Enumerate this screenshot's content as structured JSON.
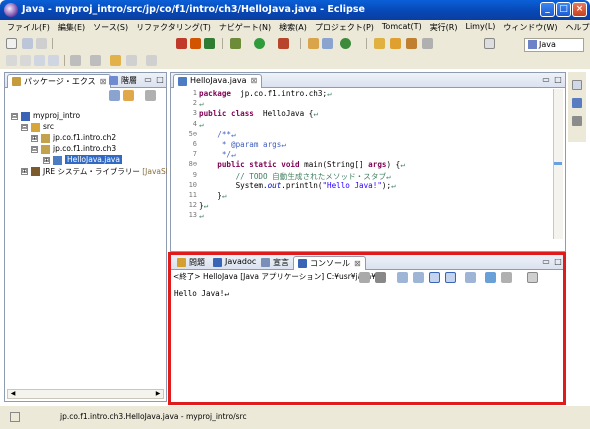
{
  "window": {
    "title": "Java - myproj_intro/src/jp/co/f1/intro/ch3/HelloJava.java - Eclipse",
    "minimize": "_",
    "maximize": "□",
    "close": "×"
  },
  "menu": [
    "ファイル(F)",
    "編集(E)",
    "ソース(S)",
    "リファクタリング(T)",
    "ナビゲート(N)",
    "検索(A)",
    "プロジェクト(P)",
    "Tomcat(T)",
    "実行(R)",
    "Limy(L)",
    "ウィンドウ(W)",
    "ヘルプ(H)"
  ],
  "perspective": {
    "label": "Java"
  },
  "package_explorer": {
    "tabs": [
      {
        "label": "パッケージ・エクス",
        "close": "⊠"
      },
      {
        "label": "階層"
      }
    ],
    "tree": [
      {
        "label": "myproj_intro",
        "expander": "⊟",
        "icon_color": "#3a64b5"
      },
      {
        "label": "src",
        "expander": "⊟",
        "icon_color": "#d6a63b"
      },
      {
        "label": "jp.co.f1.intro.ch2",
        "expander": "⊞",
        "icon_color": "#c2a24c"
      },
      {
        "label": "jp.co.f1.intro.ch3",
        "expander": "⊟",
        "icon_color": "#c2a24c"
      },
      {
        "label": "HelloJava.java",
        "expander": "⊞",
        "icon_color": "#4c7cc2",
        "selected": true
      },
      {
        "label": "JRE システム・ライブラリー",
        "suffix": "[JavaSE",
        "expander": "⊞",
        "icon_color": "#7b5a2e"
      }
    ]
  },
  "editor": {
    "tab": {
      "label": "HelloJava.java",
      "close": "⊠"
    },
    "lines": [
      {
        "n": "1",
        "parts": [
          [
            "kw",
            "package"
          ],
          [
            "",
            "  jp.co.f1.intro.ch3;"
          ],
          [
            "cm",
            "↵"
          ]
        ]
      },
      {
        "n": "2",
        "parts": [
          [
            "cm",
            "↵"
          ]
        ]
      },
      {
        "n": "3",
        "parts": [
          [
            "kw",
            "public class"
          ],
          [
            "",
            "  HelloJava {"
          ],
          [
            "cm",
            "↵"
          ]
        ]
      },
      {
        "n": "4",
        "parts": [
          [
            "cm",
            "↵"
          ]
        ]
      },
      {
        "n": "5⊖",
        "parts": [
          [
            "jd",
            "    /**↵"
          ]
        ]
      },
      {
        "n": "6",
        "parts": [
          [
            "jd",
            "     * @param args↵"
          ]
        ]
      },
      {
        "n": "7",
        "parts": [
          [
            "jd",
            "     */↵"
          ]
        ]
      },
      {
        "n": "8⊖",
        "parts": [
          [
            "kw",
            "    public static void"
          ],
          [
            "",
            " main(String[] "
          ],
          [
            "kw",
            "args"
          ],
          [
            "",
            ") {"
          ],
          [
            "cm",
            "↵"
          ]
        ]
      },
      {
        "n": "9",
        "parts": [
          [
            "cm",
            "        // TODO 自動生成されたメソッド・スタブ↵"
          ]
        ]
      },
      {
        "n": "10",
        "parts": [
          [
            "",
            "        System."
          ],
          [
            "it",
            "out"
          ],
          [
            "",
            ".println("
          ],
          [
            "str",
            "\"Hello Java!\""
          ],
          [
            "",
            ");"
          ],
          [
            "cm",
            "↵"
          ]
        ]
      },
      {
        "n": "11",
        "parts": [
          [
            "",
            "    }"
          ],
          [
            "cm",
            "↵"
          ]
        ]
      },
      {
        "n": "12",
        "parts": [
          [
            "",
            "}"
          ],
          [
            "cm",
            "↵"
          ]
        ]
      },
      {
        "n": "13",
        "parts": [
          [
            "cm",
            "↵"
          ]
        ]
      }
    ]
  },
  "console": {
    "tabs": [
      {
        "label": "問題"
      },
      {
        "label": "Javadoc"
      },
      {
        "label": "宣言"
      },
      {
        "label": "コンソール",
        "close": "⊠"
      }
    ],
    "header": "<終了> HelloJava [Java アプリケーション] C:¥usr¥java¥",
    "output": "Hello Java!↵"
  },
  "status": {
    "text": "jp.co.f1.intro.ch3.HelloJava.java - myproj_intro/src"
  }
}
